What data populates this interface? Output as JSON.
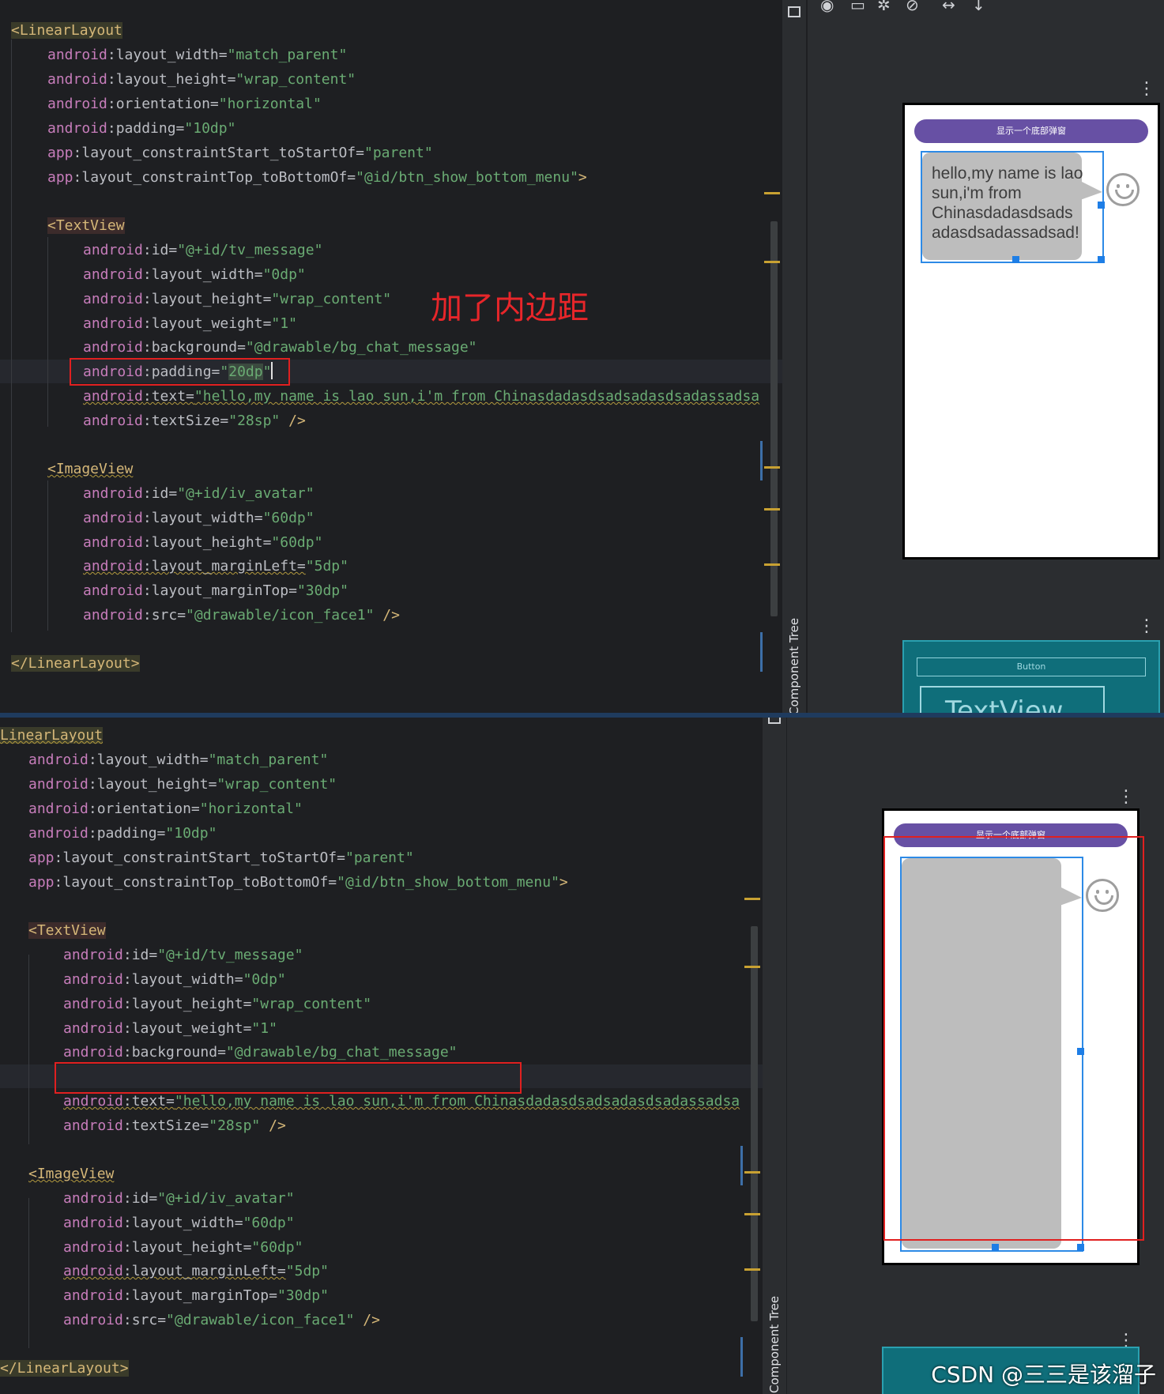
{
  "top": {
    "code": {
      "l1": "<LinearLayout",
      "layout_width": "\"match_parent\"",
      "layout_height": "\"wrap_content\"",
      "orientation": "\"horizontal\"",
      "padding": "\"10dp\"",
      "start": "\"parent\"",
      "topbottom": "\"@id/btn_show_bottom_menu\"",
      "close_angle": ">",
      "tv_tag": "<TextView",
      "tv_id": "\"@+id/tv_message\"",
      "tv_w": "\"0dp\"",
      "tv_h": "\"wrap_content\"",
      "tv_weight": "\"1\"",
      "tv_bg": "\"@drawable/bg_chat_message\"",
      "tv_padding_a": "\"",
      "tv_padding_b": "20dp",
      "tv_padding_c": "\"",
      "tv_text": "\"hello,my name is lao sun,i'm from Chinasdadasdsadsadasdsadassadsa",
      "tv_size": "\"28sp\"",
      "self_close": " />",
      "iv_tag": "<ImageView",
      "iv_id": "\"@+id/iv_avatar\"",
      "iv_w": "\"60dp\"",
      "iv_h": "\"60dp\"",
      "iv_ml": "\"5dp\"",
      "iv_mt": "\"30dp\"",
      "iv_src": "\"@drawable/icon_face1\"",
      "end_tag": "</LinearLayout>"
    },
    "annotation": "加了内边距",
    "side_tab": "Component Tree",
    "preview": {
      "button": "显示一个底部弹窗",
      "message": "hello,my name is lao sun,i'm from Chinasdadasdsads adasdsadassadsad!",
      "bp_button": "Button",
      "bp_textview": "TextView"
    }
  },
  "bottom": {
    "code": {
      "l1": "LinearLayout",
      "text_val": "\"hello,my name is lao sun,i'm from Chinasdadasdsadsadasdsadassadsa"
    },
    "side_tab": "Component Tree",
    "preview": {
      "button": "显示一个底部弹窗"
    }
  },
  "attrs": {
    "ns_android": "android",
    "ns_app": "app",
    "a_layout_width": ":layout_width=",
    "a_layout_height": ":layout_height=",
    "a_orientation": ":orientation=",
    "a_padding": ":padding=",
    "a_start": ":layout_constraintStart_toStartOf=",
    "a_top": ":layout_constraintTop_toBottomOf=",
    "a_id": ":id=",
    "a_weight": ":layout_weight=",
    "a_background": ":background=",
    "a_text": ":text=",
    "a_textsize": ":textSize=",
    "a_ml": ":layout_marginLeft=",
    "a_mt": ":layout_marginTop=",
    "a_src": ":src="
  },
  "watermark": "CSDN @三三是该溜子",
  "colors": {
    "editor_bg": "#1e1f22",
    "namespace": "#c77dbb",
    "value": "#6aab73",
    "tag": "#d5b778",
    "highlight_red": "#e02020",
    "button_purple": "#6750a4",
    "bubble_gray": "#bdbdbd",
    "selection_blue": "#2d8ae6"
  },
  "icons": [
    "eye-icon",
    "layout-icon",
    "magic-wand-icon",
    "error-icon",
    "horizontal-resize-icon",
    "vertical-arrow-icon",
    "more-vertical-icon",
    "smiley-face-icon"
  ]
}
